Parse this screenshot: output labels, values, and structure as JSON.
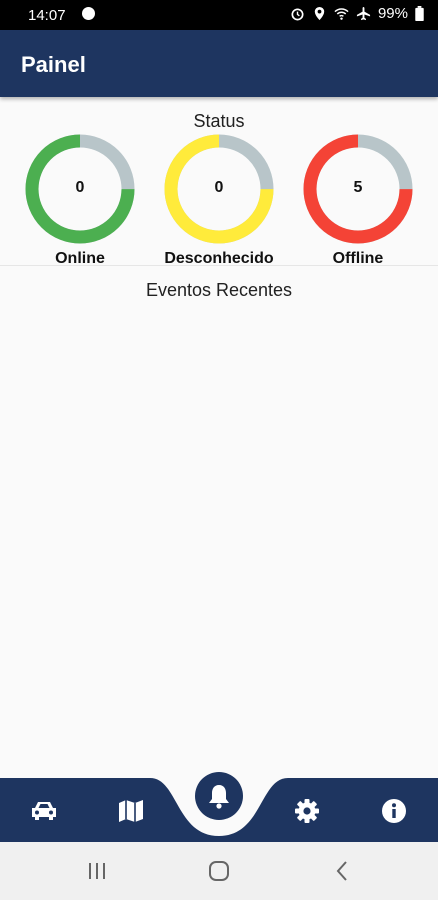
{
  "status_bar": {
    "time": "14:07",
    "battery": "99%"
  },
  "app_bar": {
    "title": "Painel"
  },
  "status_section": {
    "title": "Status",
    "gauges": [
      {
        "value": "0",
        "label": "Online",
        "color": "#4caf50",
        "fraction": 0.75
      },
      {
        "value": "0",
        "label": "Desconhecido",
        "color": "#ffeb3b",
        "fraction": 0.75
      },
      {
        "value": "5",
        "label": "Offline",
        "color": "#f44336",
        "fraction": 0.75
      }
    ],
    "track_color": "#b8c5c9"
  },
  "events_section": {
    "title": "Eventos Recentes"
  },
  "bottom_nav": {
    "items": [
      {
        "icon": "car-icon"
      },
      {
        "icon": "map-icon"
      },
      {
        "icon": "bell-icon"
      },
      {
        "icon": "gear-icon"
      },
      {
        "icon": "info-icon"
      }
    ],
    "color": "#1e3560"
  },
  "system_nav": {
    "items": [
      "recent-apps-icon",
      "home-icon",
      "back-icon"
    ]
  }
}
